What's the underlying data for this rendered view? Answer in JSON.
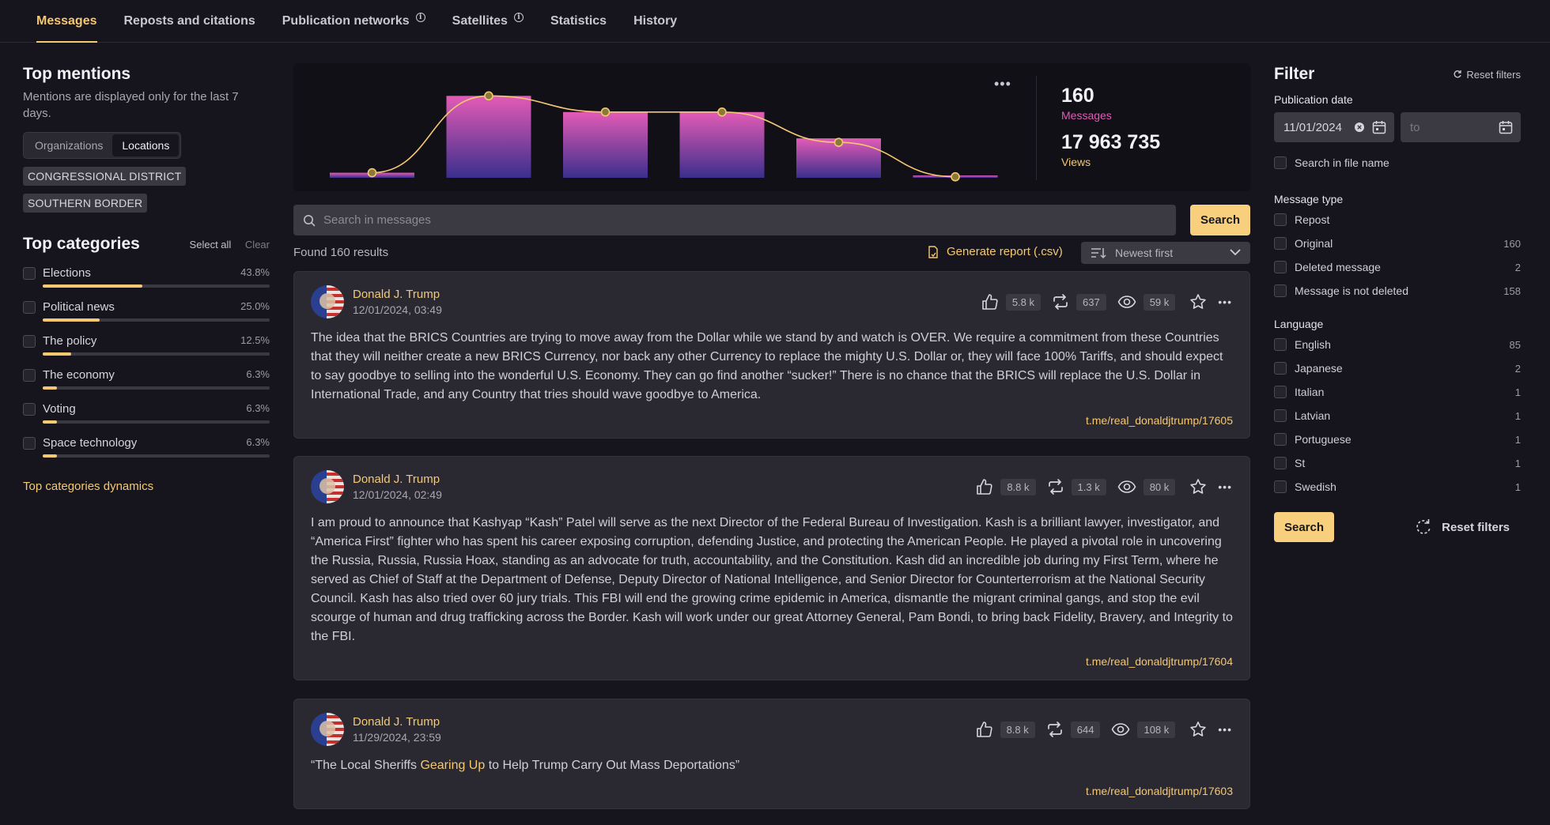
{
  "tabs": [
    {
      "label": "Messages",
      "info": false
    },
    {
      "label": "Reposts and citations",
      "info": false
    },
    {
      "label": "Publication networks",
      "info": true
    },
    {
      "label": "Satellites",
      "info": true
    },
    {
      "label": "Statistics",
      "info": false
    },
    {
      "label": "History",
      "info": false
    }
  ],
  "top_mentions": {
    "title": "Top mentions",
    "subtitle": "Mentions are displayed only for the last 7 days.",
    "segments": [
      "Organizations",
      "Locations"
    ],
    "active_segment": "Locations",
    "chips": [
      "CONGRESSIONAL DISTRICT",
      "SOUTHERN BORDER"
    ]
  },
  "top_categories": {
    "title": "Top categories",
    "select_all": "Select all",
    "clear": "Clear",
    "items": [
      {
        "label": "Elections",
        "pct_label": "43.8%",
        "value": 43.8
      },
      {
        "label": "Political news",
        "pct_label": "25.0%",
        "value": 25.0
      },
      {
        "label": "The policy",
        "pct_label": "12.5%",
        "value": 12.5
      },
      {
        "label": "The economy",
        "pct_label": "6.3%",
        "value": 6.3
      },
      {
        "label": "Voting",
        "pct_label": "6.3%",
        "value": 6.3
      },
      {
        "label": "Space technology",
        "pct_label": "6.3%",
        "value": 6.3
      }
    ],
    "dynamics_link": "Top categories dynamics"
  },
  "chart_data": {
    "type": "bar",
    "bars": [
      0.05,
      0.81,
      0.65,
      0.65,
      0.39,
      0.02
    ],
    "line": [
      0.05,
      0.81,
      0.65,
      0.65,
      0.35,
      0.01
    ],
    "colors": {
      "bar_top": "#e35bb6",
      "bar_bottom": "#3a2f8c",
      "line": "#f5c872"
    }
  },
  "summary": {
    "messages_count": "160",
    "messages_label": "Messages",
    "views_count": "17 963 735",
    "views_label": "Views"
  },
  "search": {
    "placeholder": "Search in messages",
    "button": "Search"
  },
  "results": {
    "found": "Found 160 results",
    "report": "Generate report (.csv)",
    "sort": "Newest first"
  },
  "messages": [
    {
      "author": "Donald J. Trump",
      "date": "12/01/2024, 03:49",
      "likes": "5.8 k",
      "reposts": "637",
      "views": "59 k",
      "text": "The idea that the BRICS Countries are trying to move away from the Dollar while we stand by and watch is OVER. We require a commitment from these Countries that they will neither create a new BRICS Currency, nor back any other Currency to replace the mighty U.S. Dollar or, they will face 100% Tariffs, and should expect to say goodbye to selling into the wonderful U.S. Economy. They can go find another “sucker!” There is no chance that the BRICS will replace the U.S. Dollar in International Trade, and any Country that tries should wave goodbye to America.",
      "link": "t.me/real_donaldjtrump/17605"
    },
    {
      "author": "Donald J. Trump",
      "date": "12/01/2024, 02:49",
      "likes": "8.8 k",
      "reposts": "1.3 k",
      "views": "80 k",
      "text": "I am proud to announce that Kashyap “Kash” Patel will serve as the next Director of the Federal Bureau of Investigation. Kash is a brilliant lawyer, investigator, and “America First” fighter who has spent his career exposing corruption, defending Justice, and protecting the American People. He played a pivotal role in uncovering the Russia, Russia, Russia Hoax, standing as an advocate for truth, accountability, and the Constitution. Kash did an incredible job during my First Term, where he served as Chief of Staff at the Department of Defense, Deputy Director of National Intelligence, and Senior Director for Counterterrorism at the National Security Council. Kash has also tried over 60 jury trials. This FBI will end the growing crime epidemic in America, dismantle the migrant criminal gangs, and stop the evil scourge of human and drug trafficking across the Border. Kash will work under our great Attorney General, Pam Bondi, to bring back Fidelity, Bravery, and Integrity to the FBI.",
      "link": "t.me/real_donaldjtrump/17604"
    },
    {
      "author": "Donald J. Trump",
      "date": "11/29/2024, 23:59",
      "likes": "8.8 k",
      "reposts": "644",
      "views": "108 k",
      "text_before": "“The Local Sheriffs ",
      "text_highlight": "Gearing Up",
      "text_after": " to Help Trump Carry Out Mass Deportations”",
      "link": "t.me/real_donaldjtrump/17603"
    }
  ],
  "filter": {
    "title": "Filter",
    "reset_small": "Reset filters",
    "publication_date_label": "Publication date",
    "date_from": "11/01/2024",
    "date_to_placeholder": "to",
    "search_in_file_name": "Search in file name",
    "message_type_label": "Message type",
    "message_types": [
      {
        "label": "Repost",
        "count": ""
      },
      {
        "label": "Original",
        "count": "160"
      },
      {
        "label": "Deleted message",
        "count": "2"
      },
      {
        "label": "Message is not deleted",
        "count": "158"
      }
    ],
    "language_label": "Language",
    "languages": [
      {
        "label": "English",
        "count": "85"
      },
      {
        "label": "Japanese",
        "count": "2"
      },
      {
        "label": "Italian",
        "count": "1"
      },
      {
        "label": "Latvian",
        "count": "1"
      },
      {
        "label": "Portuguese",
        "count": "1"
      },
      {
        "label": "St",
        "count": "1"
      },
      {
        "label": "Swedish",
        "count": "1"
      }
    ],
    "search_button": "Search",
    "reset_large": "Reset filters"
  }
}
